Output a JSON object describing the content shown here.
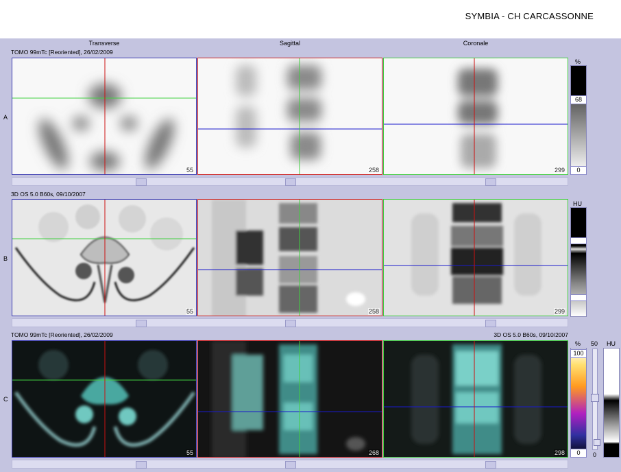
{
  "header": {
    "site": "SYMBIA - CH CARCASSONNE"
  },
  "columns": {
    "transverse": "Transverse",
    "sagittal": "Sagittal",
    "coronal": "Coronale"
  },
  "rows": {
    "a": {
      "letter": "A",
      "series": "TOMO 99mTc [Reoriented], 26/02/2009",
      "slices": {
        "transverse": "55",
        "sagittal": "258",
        "coronal": "299"
      }
    },
    "b": {
      "letter": "B",
      "series": "3D  OS  5.0  B60s, 09/10/2007",
      "slices": {
        "transverse": "55",
        "sagittal": "258",
        "coronal": "299"
      }
    },
    "c": {
      "letter": "C",
      "series_left": "TOMO 99mTc [Reoriented], 26/02/2009",
      "series_right": "3D  OS  5.0  B60s, 09/10/2007",
      "slices": {
        "transverse": "55",
        "sagittal": "268",
        "coronal": "298"
      }
    }
  },
  "colorbars": {
    "a": {
      "unit": "%",
      "upper": "68",
      "lower": "0"
    },
    "b": {
      "unit": "HU"
    },
    "c": {
      "unit_pct": "%",
      "upper_pct": "100",
      "lower_pct": "0",
      "slider_top": "50",
      "slider_bottom": "0",
      "unit_hu": "HU"
    }
  },
  "colors": {
    "transverse_frame": "#3a3ab0",
    "sagittal_frame": "#cc2020",
    "coronal_frame": "#40cc40",
    "crosshair_red": "#cc1010",
    "crosshair_green": "#40d040",
    "crosshair_blue": "#1a1acc",
    "background": "#c4c4e0"
  }
}
